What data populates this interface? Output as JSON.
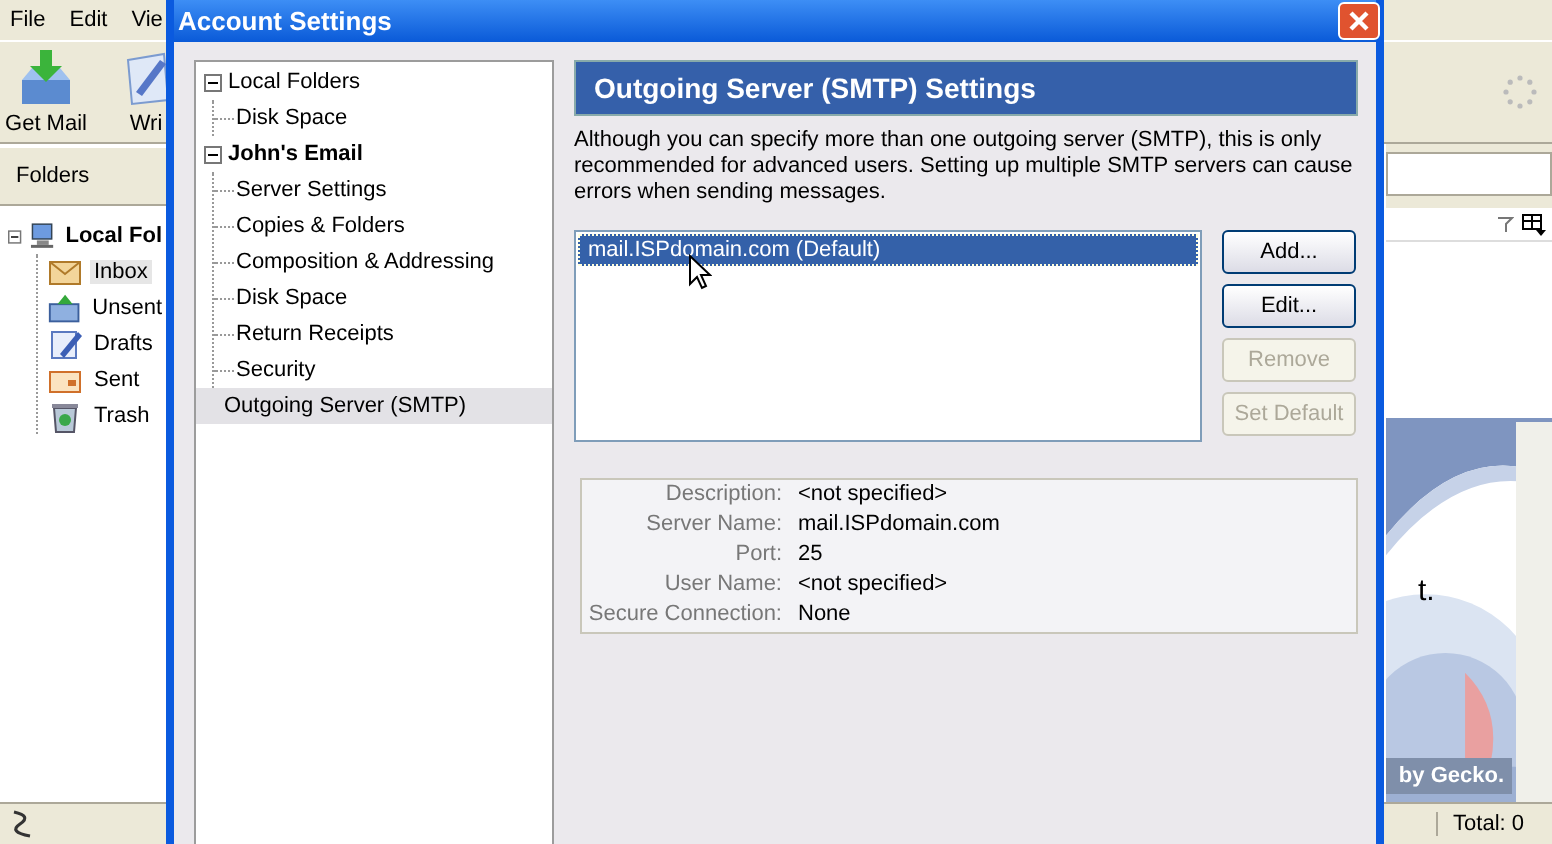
{
  "app": {
    "menu": [
      "File",
      "Edit",
      "Vie"
    ],
    "toolbar": [
      {
        "label": "Get Mail",
        "kind": "getmail"
      },
      {
        "label": "Wri",
        "kind": "write"
      }
    ],
    "folders_header": "Folders",
    "folders": [
      {
        "label": "Local Fol",
        "kind": "computer",
        "expanded": true,
        "selected": false,
        "children": [
          {
            "label": "Inbox",
            "kind": "inbox",
            "selected": true
          },
          {
            "label": "Unsent",
            "kind": "unsent",
            "selected": false
          },
          {
            "label": "Drafts",
            "kind": "drafts",
            "selected": false
          },
          {
            "label": "Sent",
            "kind": "sent",
            "selected": false
          },
          {
            "label": "Trash",
            "kind": "trash",
            "selected": false
          }
        ]
      }
    ],
    "preview_text": "t.",
    "preview_footer": "by Gecko.",
    "status_total": "Total: 0"
  },
  "dialog": {
    "title": "Account Settings",
    "tree": [
      {
        "label": "Local Folders",
        "bold": false,
        "expanded": true,
        "selected": false,
        "children": [
          {
            "label": "Disk Space",
            "selected": false
          }
        ]
      },
      {
        "label": "John's Email",
        "bold": true,
        "expanded": true,
        "selected": false,
        "children": [
          {
            "label": "Server Settings",
            "selected": false
          },
          {
            "label": "Copies & Folders",
            "selected": false
          },
          {
            "label": "Composition & Addressing",
            "selected": false
          },
          {
            "label": "Disk Space",
            "selected": false
          },
          {
            "label": "Return Receipts",
            "selected": false
          },
          {
            "label": "Security",
            "selected": false
          }
        ]
      },
      {
        "label": "Outgoing Server (SMTP)",
        "bold": false,
        "selected": true
      }
    ],
    "heading": "Outgoing Server (SMTP) Settings",
    "description": "Although you can specify more than one outgoing server (SMTP), this is only recommended for advanced users. Setting up multiple SMTP servers can cause errors when sending messages.",
    "servers": [
      {
        "label": "mail.ISPdomain.com (Default)",
        "selected": true
      }
    ],
    "buttons": [
      {
        "label": "Add...",
        "disabled": false
      },
      {
        "label": "Edit...",
        "disabled": false
      },
      {
        "label": "Remove",
        "disabled": true
      },
      {
        "label": "Set Default",
        "disabled": true
      }
    ],
    "details": [
      {
        "label": "Description:",
        "value": "<not specified>"
      },
      {
        "label": "Server Name:",
        "value": "mail.ISPdomain.com"
      },
      {
        "label": "Port:",
        "value": "25"
      },
      {
        "label": "User Name:",
        "value": "<not specified>"
      },
      {
        "label": "Secure Connection:",
        "value": "None"
      }
    ]
  }
}
